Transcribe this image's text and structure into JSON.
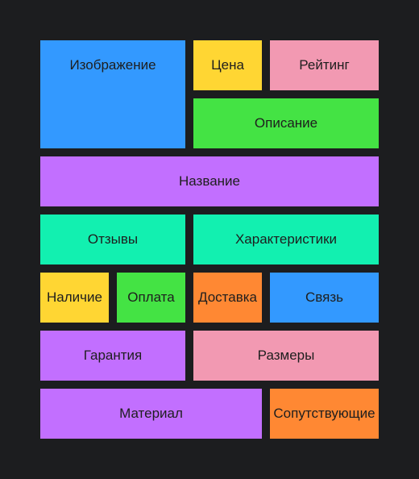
{
  "colors": {
    "background": "#1c1d1f",
    "blue": "#3399ff",
    "yellow": "#ffd633",
    "pink": "#f299b2",
    "green": "#44e344",
    "purple": "#c26fff",
    "teal": "#12f0b0",
    "orange": "#ff8833"
  },
  "tiles": {
    "image": {
      "label": "Изображение",
      "color": "#3399ff"
    },
    "price": {
      "label": "Цена",
      "color": "#ffd633"
    },
    "rating": {
      "label": "Рейтинг",
      "color": "#f299b2"
    },
    "description": {
      "label": "Описание",
      "color": "#44e344"
    },
    "name": {
      "label": "Название",
      "color": "#c26fff"
    },
    "reviews": {
      "label": "Отзывы",
      "color": "#12f0b0"
    },
    "specs": {
      "label": "Характеристики",
      "color": "#12f0b0"
    },
    "availability": {
      "label": "Наличие",
      "color": "#ffd633"
    },
    "payment": {
      "label": "Оплата",
      "color": "#44e344"
    },
    "delivery": {
      "label": "Доставка",
      "color": "#ff8833"
    },
    "contact": {
      "label": "Связь",
      "color": "#3399ff"
    },
    "warranty": {
      "label": "Гарантия",
      "color": "#c26fff"
    },
    "sizes": {
      "label": "Размеры",
      "color": "#f299b2"
    },
    "material": {
      "label": "Материал",
      "color": "#c26fff"
    },
    "related": {
      "label": "Сопутствующие",
      "color": "#ff8833"
    }
  }
}
